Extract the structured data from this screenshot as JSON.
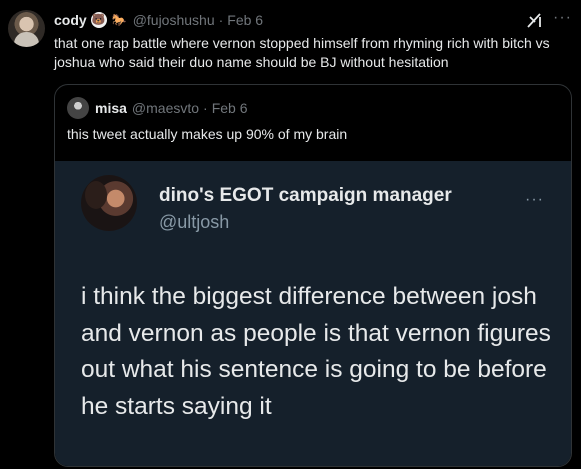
{
  "tweet": {
    "author_name": "cody",
    "author_emojis": [
      "🐻‍❄️",
      "🐎"
    ],
    "handle": "@fujoshushu",
    "separator": "·",
    "date": "Feb 6",
    "more": "···",
    "text": "that one rap battle where vernon stopped himself from rhyming rich with bitch vs joshua who said their duo name should be BJ without hesitation"
  },
  "quote": {
    "author_name": "misa",
    "handle": "@maesvto",
    "separator": "·",
    "date": "Feb 6",
    "text": "this tweet actually makes up 90% of my brain",
    "media": {
      "name": "dino's EGOT campaign manager",
      "handle": "@ultjosh",
      "more": "···",
      "text": "i think the biggest difference between josh and vernon as people is that vernon figures out what his sentence is going to be before he starts saying it"
    }
  },
  "colors": {
    "background": "#000000",
    "text": "#e7e9ea",
    "secondary": "#71767b",
    "media_background": "#15202b",
    "border": "#2f3336"
  }
}
